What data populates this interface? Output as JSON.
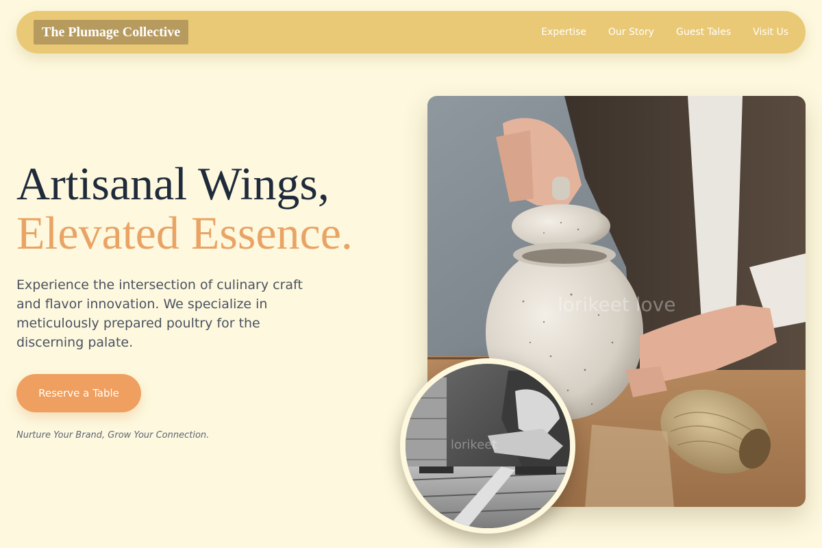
{
  "navbar": {
    "brand": "The Plumage Collective",
    "links": [
      "Expertise",
      "Our Story",
      "Guest Tales",
      "Visit Us"
    ]
  },
  "hero": {
    "title_line1": "Artisanal Wings,",
    "title_line2": "Elevated Essence.",
    "description": "Experience the intersection of culinary craft and flavor innovation. We specialize in meticulously prepared poultry for the discerning palate.",
    "cta_label": "Reserve a Table",
    "tagline": "Nurture Your Brand, Grow Your Connection."
  },
  "images": {
    "main_watermark": "lorikeet love",
    "inset_watermark": "lorikeet"
  },
  "colors": {
    "background": "#fdf8de",
    "navbar": "#e9c975",
    "brand_box": "#b79b5e",
    "title_dark": "#1f2a3a",
    "title_accent": "#e9a364",
    "cta": "#ef9f5f"
  }
}
